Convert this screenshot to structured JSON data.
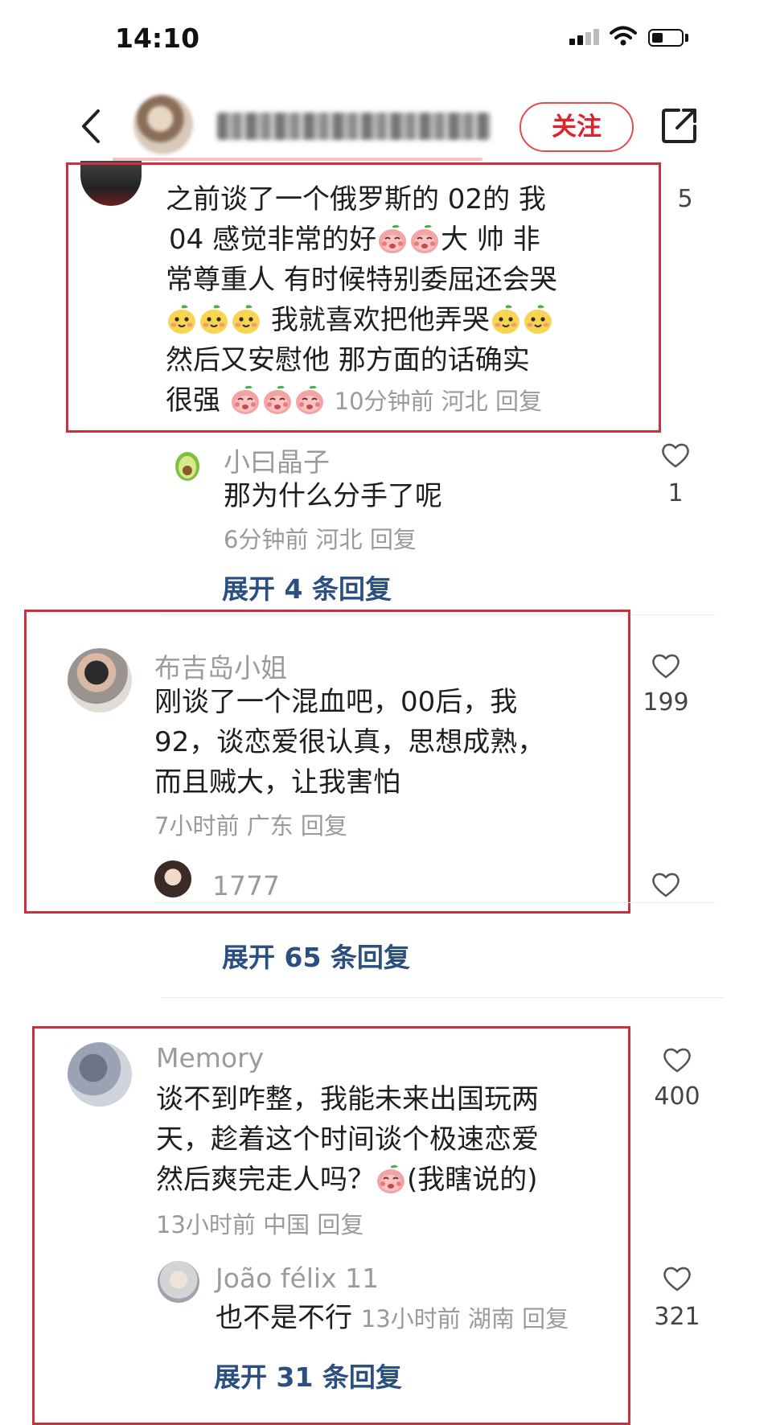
{
  "status_bar": {
    "time": "14:10"
  },
  "header": {
    "follow_label": "关注"
  },
  "comments": [
    {
      "lines": [
        "之前谈了一个俄罗斯的 02的 我",
        "04 感觉非常的好",
        "大 帅 非",
        "常尊重人 有时候特别委屈还会哭",
        "我就喜欢把他弄哭",
        "然后又安慰他 那方面的话确实",
        "很强"
      ],
      "meta": "10分钟前 河北 回复",
      "likes": "5",
      "reply": {
        "user": "小曰晶子",
        "text": "那为什么分手了呢",
        "meta": "6分钟前 河北 回复",
        "likes": "1"
      },
      "expand": "展开 4 条回复"
    },
    {
      "user": "布吉岛小姐",
      "lines": [
        "刚谈了一个混血吧，00后，我",
        "92，谈恋爱很认真，思想成熟，",
        "而且贼大，让我害怕"
      ],
      "meta": "7小时前 广东 回复",
      "likes": "199",
      "reply": {
        "user": "1777"
      },
      "expand": "展开 65 条回复"
    },
    {
      "user": "Memory",
      "lines": [
        "谈不到咋整，我能未来出国玩两",
        "天，趁着这个时间谈个极速恋爱",
        "然后爽完走人吗？",
        "(我瞎说的)"
      ],
      "meta": "13小时前 中国 回复",
      "likes": "400",
      "reply": {
        "user": "João félix 11",
        "text": "也不是不行",
        "meta": "13小时前 湖南 回复",
        "likes": "321"
      },
      "expand": "展开 31 条回复"
    }
  ],
  "colors": {
    "accent_red": "#e0222d",
    "frame_red": "#c9313f",
    "link_blue": "#2b4f80"
  },
  "icons": [
    "back-icon",
    "share-icon",
    "heart-icon",
    "shy-peach-emoji",
    "blush-face-emoji",
    "avocado-avatar"
  ]
}
